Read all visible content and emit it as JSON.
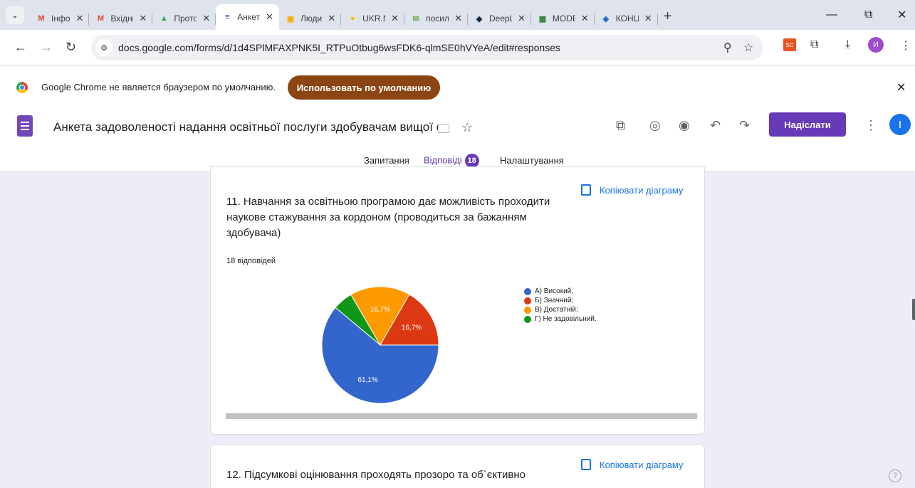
{
  "browser": {
    "tabs": [
      {
        "label": "Інфо",
        "icon": "gmail-icon",
        "icon_char": "M",
        "icon_color": "#ea4335"
      },
      {
        "label": "Вхідні",
        "icon": "gmail-icon",
        "icon_char": "M",
        "icon_color": "#ea4335"
      },
      {
        "label": "Прото",
        "icon": "drive-icon",
        "icon_char": "▲",
        "icon_color": "#34a853"
      },
      {
        "label": "Анкет",
        "icon": "forms-icon",
        "icon_char": "≡",
        "icon_color": "#673ab7",
        "active": true
      },
      {
        "label": "Люди",
        "icon": "contacts-icon",
        "icon_char": "▣",
        "icon_color": "#f9ab00"
      },
      {
        "label": "UKR.N",
        "icon": "ukrnet-icon",
        "icon_char": "●",
        "icon_color": "#fbbc04"
      },
      {
        "label": "посил",
        "icon": "mail-icon",
        "icon_char": "✉",
        "icon_color": "#6aa84f"
      },
      {
        "label": "DeepL",
        "icon": "deepl-icon",
        "icon_char": "◆",
        "icon_color": "#0f2b46"
      },
      {
        "label": "MODE",
        "icon": "mode-icon",
        "icon_char": "▦",
        "icon_color": "#2e7d32"
      },
      {
        "label": "КОНЦ",
        "icon": "shield-icon",
        "icon_char": "◈",
        "icon_color": "#1565c0"
      }
    ],
    "url": "docs.google.com/forms/d/1d4SPlMFAXPNK5I_RTPuOtbug6wsFDK6-qlmSE0hVYeA/edit#responses",
    "profile_initial": "И"
  },
  "infobar": {
    "message": "Google Chrome не является браузером по умолчанию.",
    "button_label": "Использовать по умолчанию"
  },
  "form": {
    "title": "Анкета задоволеності надання освітньої послуги здобувачам вищої ос",
    "send_label": "Надіслати",
    "avatar_initial": "I",
    "tabs": {
      "questions": "Запитання",
      "responses": "Відповіді",
      "responses_count": "18",
      "settings": "Налаштування"
    }
  },
  "questions": [
    {
      "title": "11. Навчання за освітньою програмою дає можливість проходити наукове стажування за кордоном (проводиться за бажанням здобувача)",
      "copy_label": "Копіювати діаграму",
      "responses_label": "18 відповідей"
    },
    {
      "title": "12. Підсумкові оцінювання проходять прозоро та об`єктивно",
      "copy_label": "Копіювати діаграму"
    }
  ],
  "chart_data": {
    "type": "pie",
    "categories": [
      "А) Високий;",
      "Б) Значний;",
      "В) Достатній;",
      "Г) Не задовільний."
    ],
    "values": [
      61.1,
      16.7,
      16.7,
      5.5
    ],
    "value_labels": [
      "61,1%",
      "16,7%",
      "16,7%",
      ""
    ],
    "colors": [
      "#3366cc",
      "#dc3912",
      "#ff9900",
      "#109618"
    ],
    "legend_position": "right"
  }
}
